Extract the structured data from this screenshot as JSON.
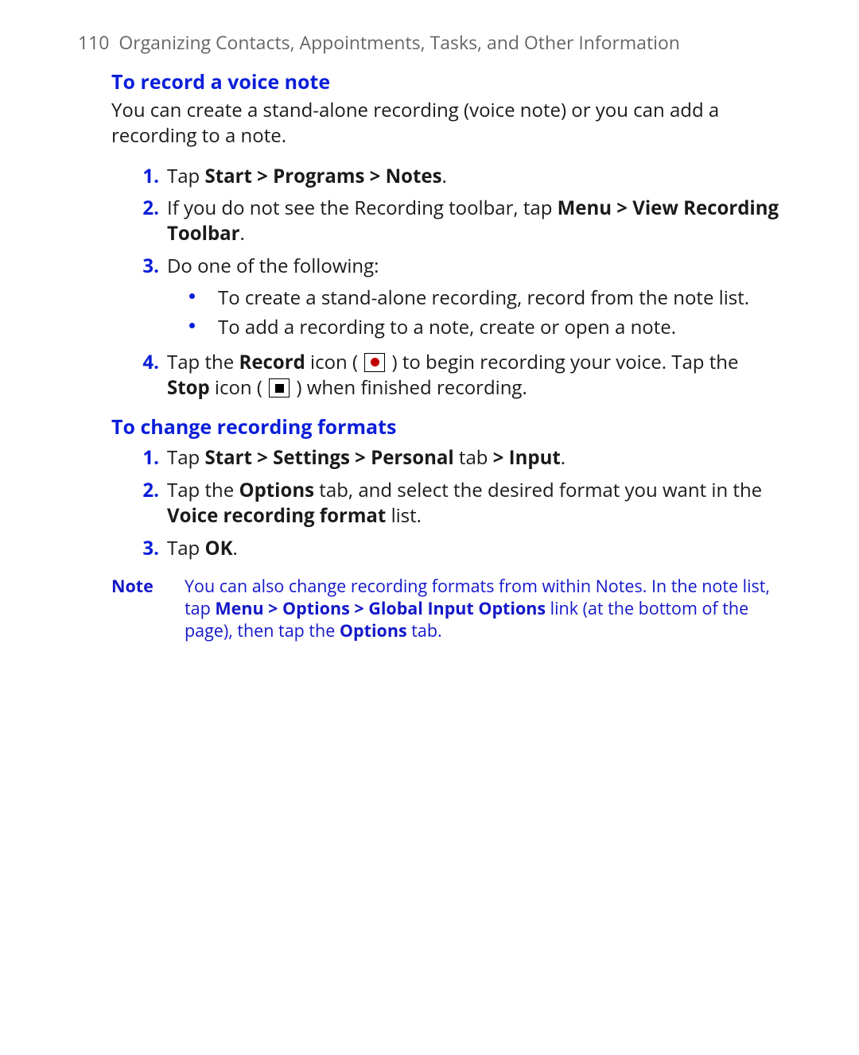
{
  "header": {
    "page_number": "110",
    "chapter_title": "Organizing Contacts, Appointments, Tasks, and Other Information"
  },
  "section1": {
    "heading": "To record a voice note",
    "intro": "You can create a stand-alone recording (voice note) or you can add a recording to a note.",
    "steps": {
      "1": {
        "num": "1.",
        "pre": "Tap ",
        "b1": "Start > Programs > Notes",
        "post": "."
      },
      "2": {
        "num": "2.",
        "pre": "If you do not see the Recording toolbar, tap ",
        "b1": "Menu > View Recording Toolbar",
        "post": "."
      },
      "3": {
        "num": "3.",
        "text": "Do one of the following:",
        "bullets": {
          "a": "To create a stand-alone recording, record from the note list.",
          "b": "To add a recording to a note, create or open a note."
        }
      },
      "4": {
        "num": "4.",
        "p1": "Tap the ",
        "b1": "Record",
        "p2": " icon ( ",
        "p3": " ) to begin recording your voice. Tap the ",
        "b2": "Stop",
        "p4": " icon ( ",
        "p5": " ) when finished recording."
      }
    }
  },
  "section2": {
    "heading": "To change recording formats",
    "steps": {
      "1": {
        "num": "1.",
        "p1": "Tap ",
        "b1": "Start > Settings > Personal",
        "p2": " tab ",
        "b2": "> Input",
        "p3": "."
      },
      "2": {
        "num": "2.",
        "p1": "Tap the ",
        "b1": "Options",
        "p2": " tab, and select the desired format you want in the ",
        "b2": "Voice recording format",
        "p3": " list."
      },
      "3": {
        "num": "3.",
        "p1": "Tap ",
        "b1": "OK",
        "p2": "."
      }
    }
  },
  "note": {
    "label": "Note",
    "t1": "You can also change recording formats from within Notes. In the note list, tap ",
    "b1": "Menu > Options > Global Input Options",
    "t2": " link (at the bottom of the page), then tap the ",
    "b2": "Options",
    "t3": " tab."
  }
}
